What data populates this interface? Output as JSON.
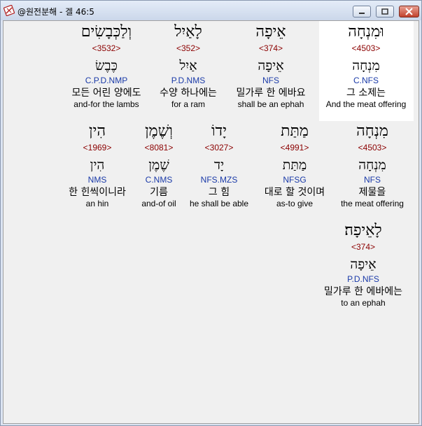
{
  "window": {
    "title": "@원전분해 - 겔 46:5",
    "icon": "bible-book-icon",
    "buttons": [
      "minimize",
      "maximize",
      "close"
    ]
  },
  "rows": [
    [
      {
        "hebrew": "וּמִנְחָה",
        "strong": "<4503>",
        "lemma": "מִנְחָה",
        "parse": "C.NFS",
        "korean": "그 소제는",
        "english": "And the meat offering",
        "highlighted": true
      },
      {
        "hebrew": "אֵיפָה",
        "strong": "<374>",
        "lemma": "אֵיפָה",
        "parse": "NFS",
        "korean": "밀가루 한 에바요",
        "english": "shall be an ephah"
      },
      {
        "hebrew": "לָאַיִל",
        "strong": "<352>",
        "lemma": "אַיִל",
        "parse": "P.D.NMS",
        "korean": "수양 하나에는",
        "english": "for a ram"
      },
      {
        "hebrew": "וְלַכְּבָשִׂים",
        "strong": "<3532>",
        "lemma": "כֶּבֶשׂ",
        "parse": "C.P.D.NMP",
        "korean": "모든 어린 양에도",
        "english": "and-for the lambs"
      }
    ],
    [
      {
        "hebrew": "מִנְחָה",
        "strong": "<4503>",
        "lemma": "מִנְחָה",
        "parse": "NFS",
        "korean": "제물을",
        "english": "the meat offering"
      },
      {
        "hebrew": "מַתַּת",
        "strong": "<4991>",
        "lemma": "מַתַּת",
        "parse": "NFSG",
        "korean": "대로 할 것이며",
        "english": "as-to give"
      },
      {
        "hebrew": "יָדוֹ",
        "strong": "<3027>",
        "lemma": "יָד",
        "parse": "NFS.MZS",
        "korean": "그 힘",
        "english": "he shall be able"
      },
      {
        "hebrew": "וְשֶׁמֶן",
        "strong": "<8081>",
        "lemma": "שֶׁמֶן",
        "parse": "C.NMS",
        "korean": "기름",
        "english": "and-of oil"
      },
      {
        "hebrew": "הִין",
        "strong": "<1969>",
        "lemma": "הִין",
        "parse": "NMS",
        "korean": "한 힌씩이니라",
        "english": "an hin"
      }
    ],
    [
      {
        "hebrew": "לָאֵיפָה׃",
        "strong": "<374>",
        "lemma": "אֵיפָה",
        "parse": "P.D.NFS",
        "korean": "밀가루 한 에바에는",
        "english": "to an ephah"
      }
    ]
  ]
}
